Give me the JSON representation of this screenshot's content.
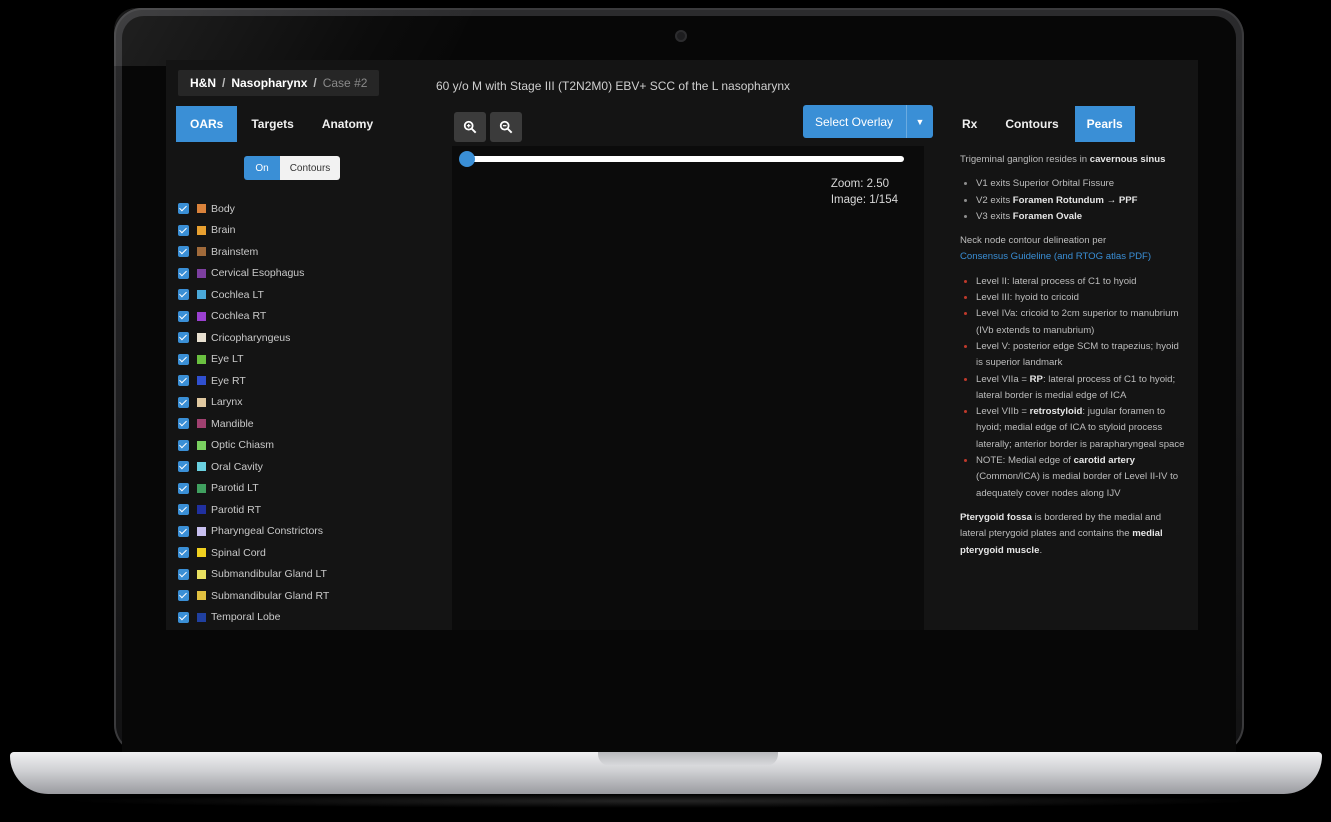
{
  "breadcrumb": {
    "part1": "H&N",
    "sep": "/",
    "part2": "Nasopharynx",
    "part3": "Case #2"
  },
  "case_title": "60 y/o M with Stage III (T2N2M0) EBV+ SCC of the L nasopharynx",
  "left_tabs": [
    "OARs",
    "Targets",
    "Anatomy"
  ],
  "toggle": {
    "on": "On",
    "off": "Contours"
  },
  "organs": [
    {
      "name": "Body",
      "color": "#d9823b"
    },
    {
      "name": "Brain",
      "color": "#e8a030"
    },
    {
      "name": "Brainstem",
      "color": "#a06a3a"
    },
    {
      "name": "Cervical Esophagus",
      "color": "#7d3fa0"
    },
    {
      "name": "Cochlea LT",
      "color": "#4aa8d8"
    },
    {
      "name": "Cochlea RT",
      "color": "#9a40d0"
    },
    {
      "name": "Cricopharyngeus",
      "color": "#e8e0d0"
    },
    {
      "name": "Eye LT",
      "color": "#6ac040"
    },
    {
      "name": "Eye RT",
      "color": "#3050d0"
    },
    {
      "name": "Larynx",
      "color": "#e0c8a0"
    },
    {
      "name": "Mandible",
      "color": "#a04070"
    },
    {
      "name": "Optic Chiasm",
      "color": "#7ad060"
    },
    {
      "name": "Oral Cavity",
      "color": "#6ad0e0"
    },
    {
      "name": "Parotid LT",
      "color": "#40a060"
    },
    {
      "name": "Parotid RT",
      "color": "#2030a0"
    },
    {
      "name": "Pharyngeal Constrictors",
      "color": "#c8c0f0"
    },
    {
      "name": "Spinal Cord",
      "color": "#f0d020"
    },
    {
      "name": "Submandibular Gland LT",
      "color": "#e8e060"
    },
    {
      "name": "Submandibular Gland RT",
      "color": "#e0c040"
    },
    {
      "name": "Temporal Lobe",
      "color": "#2040a0"
    }
  ],
  "overlay_label": "Select Overlay",
  "slider_fraction": 0.0,
  "zoom_text": "Zoom: 2.50",
  "image_text": "Image: 1/154",
  "right_tabs": [
    "Rx",
    "Contours",
    "Pearls"
  ],
  "pearls": {
    "p1_text": "Trigeminal ganglion resides in ",
    "p1_bold": "cavernous sinus",
    "p1_items": [
      {
        "text": "V1 exits Superior Orbital Fissure",
        "bold": ""
      },
      {
        "text": "V2 exits ",
        "bold": "Foramen Rotundum → PPF"
      },
      {
        "text": "V3 exits ",
        "bold": "Foramen Ovale"
      }
    ],
    "p2_text": "Neck node contour delineation per",
    "p2_link": "Consensus Guideline",
    "p2_link2": "(and RTOG atlas PDF)",
    "p2_items": [
      {
        "pre": "Level II: lateral process of C1 to hyoid",
        "bold": "",
        "post": ""
      },
      {
        "pre": "Level III: hyoid to cricoid",
        "bold": "",
        "post": ""
      },
      {
        "pre": "Level IVa: cricoid to 2cm superior to manubrium (IVb extends to manubrium)",
        "bold": "",
        "post": ""
      },
      {
        "pre": "Level V: posterior edge SCM to trapezius; hyoid is superior landmark",
        "bold": "",
        "post": ""
      },
      {
        "pre": "Level VIIa = ",
        "bold": "RP",
        "post": ": lateral process of C1 to hyoid; lateral border is medial edge of ICA"
      },
      {
        "pre": "Level VIIb = ",
        "bold": "retrostyloid",
        "post": ": jugular foramen to hyoid; medial edge of ICA to styloid process laterally; anterior border is parapharyngeal space"
      },
      {
        "pre": "NOTE: Medial edge of ",
        "bold": "carotid artery",
        "post": " (Common/ICA) is medial border of Level II-IV to adequately cover nodes along IJV"
      }
    ],
    "p3_bold": "Pterygoid fossa",
    "p3_text": " is bordered by the medial and lateral pterygoid plates and contains the ",
    "p3_bold2": "medial pterygoid muscle",
    "p3_end": "."
  }
}
